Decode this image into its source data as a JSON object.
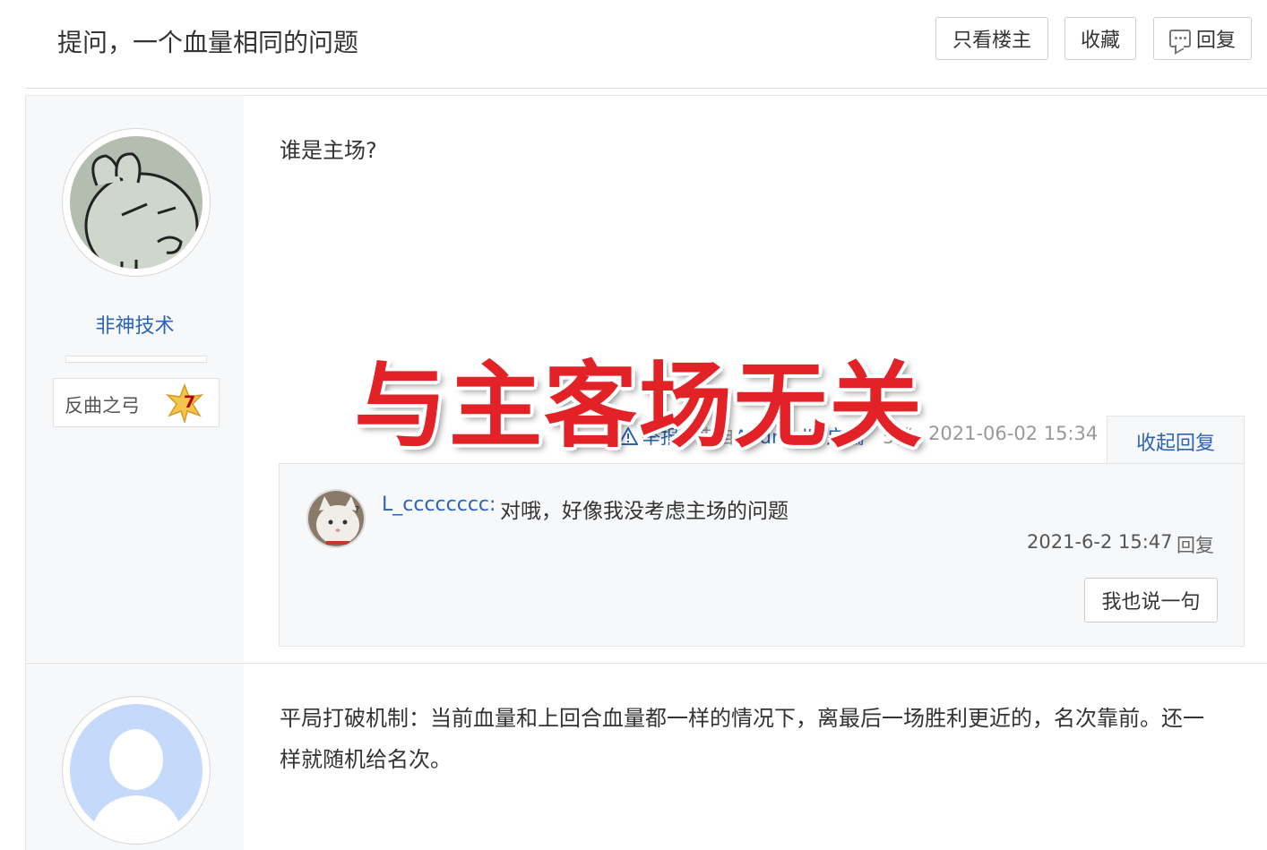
{
  "header": {
    "title": "提问，一个血量相同的问题",
    "buttons": {
      "only_op": "只看楼主",
      "favorite": "收藏",
      "reply": "回复"
    }
  },
  "post1": {
    "author": "非神技术",
    "badge": {
      "title": "反曲之弓",
      "level": "7"
    },
    "content": "谁是主场?",
    "overlay_text": "与主客场无关",
    "tail": {
      "report": "举报",
      "from_prefix": "来自",
      "from_client": "Android客户端",
      "floor": "5楼",
      "time": "2021-06-02 15:34",
      "collapse": "收起回复"
    },
    "replies": [
      {
        "user": "L_cccccccc:",
        "text": "对哦，好像我没考虑主场的问题",
        "time": "2021-6-2 15:47",
        "reply": "回复"
      }
    ],
    "say_button": "我也说一句"
  },
  "post2": {
    "content": "平局打破机制：当前血量和上回合血量都一样的情况下，离最后一场胜利更近的，名次靠前。还一样就随机给名次。"
  },
  "colors": {
    "link": "#2d64b3",
    "overlay": "#e32227",
    "sidebar": "#f7f8fa"
  }
}
